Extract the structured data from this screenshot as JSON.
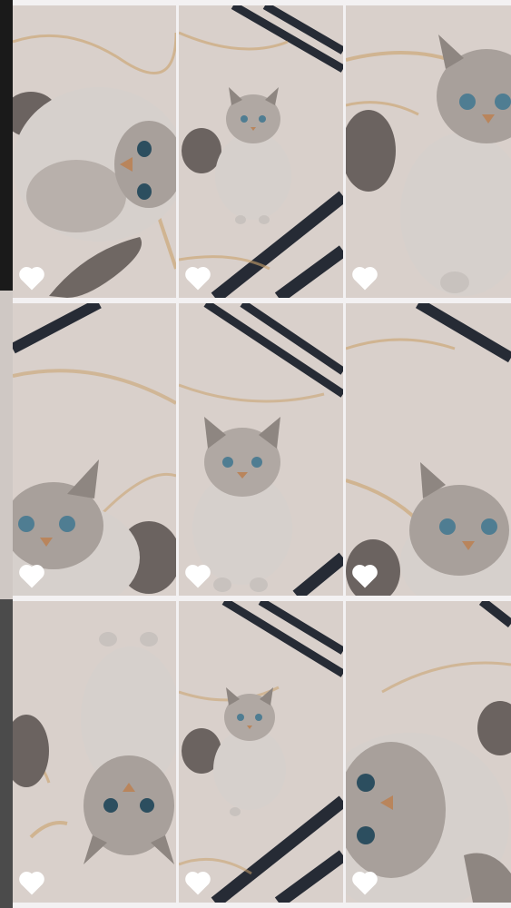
{
  "gallery": {
    "tiles": [
      {
        "pose": "looking-up",
        "liked": false
      },
      {
        "pose": "sitting-far",
        "liked": false
      },
      {
        "pose": "sitting-close",
        "liked": false
      },
      {
        "pose": "face-low-left",
        "liked": false
      },
      {
        "pose": "sitting-center",
        "liked": false
      },
      {
        "pose": "face-low-right",
        "liked": false
      },
      {
        "pose": "upside-down",
        "liked": false
      },
      {
        "pose": "sitting-far",
        "liked": false
      },
      {
        "pose": "face-bottom-rotated",
        "liked": false
      }
    ],
    "icon": "heart-outline-icon"
  },
  "colors": {
    "floor": "#d9d0cb",
    "marble_vein": "#c9a16b",
    "stripe": "#262b35",
    "fur_light": "#d6d0cc",
    "fur_dark": "#7c7470",
    "eyes": "#4f7d92",
    "nose": "#b9855c",
    "heart": "#ffffff"
  }
}
